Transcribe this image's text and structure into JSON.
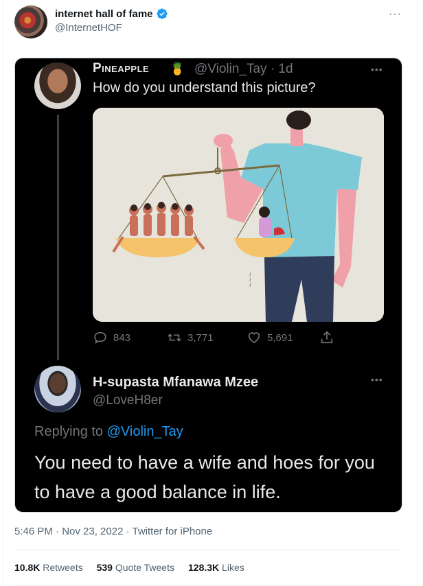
{
  "account": {
    "display_name": "internet hall of fame",
    "handle": "@InternetHOF",
    "more_icon": "ellipsis-icon"
  },
  "embedded": {
    "tweet1": {
      "name": "Pineapple",
      "emoji": "🍍",
      "handle_time": "@Violin_Tay · 1d",
      "text": "How do you understand this picture?",
      "replies": "843",
      "retweets": "3,771",
      "likes": "5,691"
    },
    "tweet2": {
      "name": "H-supasta Mfanawa Mzee",
      "handle": "@LoveH8er",
      "replying_prefix": "Replying to ",
      "replying_to": "@Violin_Tay",
      "text": "You need to have a wife and hoes for you to have a good balance in life."
    }
  },
  "footer": {
    "timestamp": "5:46 PM · Nov 23, 2022 · Twitter for iPhone",
    "retweets_count": "10.8K",
    "retweets_label": "Retweets",
    "quote_count": "539",
    "quote_label": "Quote Tweets",
    "likes_count": "128.3K",
    "likes_label": "Likes"
  },
  "colors": {
    "accent": "#1d9bf0",
    "dark_bg": "#000000",
    "muted": "#536471"
  }
}
